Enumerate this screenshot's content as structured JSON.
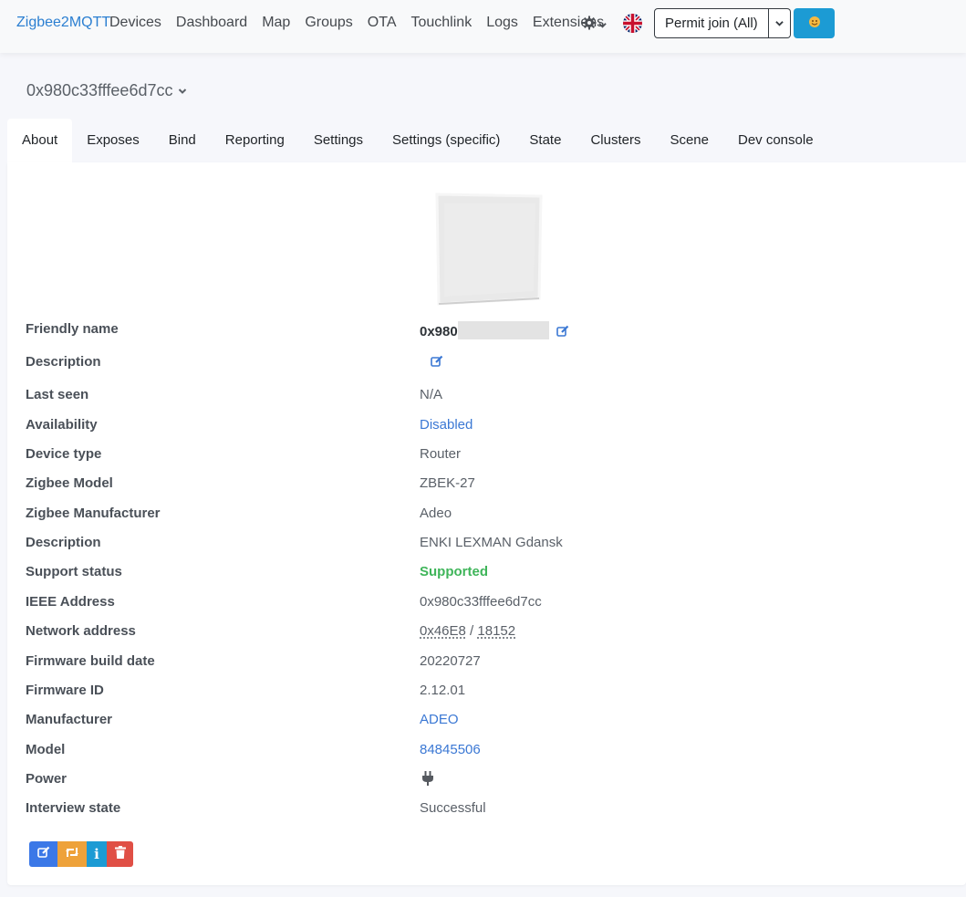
{
  "navbar": {
    "brand": "Zigbee2MQTT",
    "links": [
      "Devices",
      "Dashboard",
      "Map",
      "Groups",
      "OTA",
      "Touchlink",
      "Logs",
      "Extensions"
    ],
    "settings_icon": "gear-icon",
    "language_icon": "uk-flag-icon",
    "permit_join_label": "Permit join (All)",
    "donate_icon": "donate-icon"
  },
  "device_select": {
    "label": "0x980c33fffee6d7cc"
  },
  "tabs": [
    "About",
    "Exposes",
    "Bind",
    "Reporting",
    "Settings",
    "Settings (specific)",
    "State",
    "Clusters",
    "Scene",
    "Dev console"
  ],
  "active_tab": "About",
  "about": {
    "friendly_name": {
      "label": "Friendly name",
      "value": "0x980"
    },
    "description_edit": {
      "label": "Description"
    },
    "last_seen": {
      "label": "Last seen",
      "value": "N/A"
    },
    "availability": {
      "label": "Availability",
      "value": "Disabled"
    },
    "device_type": {
      "label": "Device type",
      "value": "Router"
    },
    "zigbee_model": {
      "label": "Zigbee Model",
      "value": "ZBEK-27"
    },
    "zigbee_manufacturer": {
      "label": "Zigbee Manufacturer",
      "value": "Adeo"
    },
    "description": {
      "label": "Description",
      "value": "ENKI LEXMAN Gdansk"
    },
    "support_status": {
      "label": "Support status",
      "value": "Supported"
    },
    "ieee_address": {
      "label": "IEEE Address",
      "value": "0x980c33fffee6d7cc"
    },
    "network_address": {
      "label": "Network address",
      "hex": "0x46E8",
      "separator": " / ",
      "dec": "18152"
    },
    "firmware_build_date": {
      "label": "Firmware build date",
      "value": "20220727"
    },
    "firmware_id": {
      "label": "Firmware ID",
      "value": "2.12.01"
    },
    "manufacturer": {
      "label": "Manufacturer",
      "value": "ADEO"
    },
    "model": {
      "label": "Model",
      "value": "84845506"
    },
    "power": {
      "label": "Power",
      "icon": "plug-icon"
    },
    "interview_state": {
      "label": "Interview state",
      "value": "Successful"
    }
  },
  "actions": {
    "rename_icon": "edit-icon",
    "reconfigure_icon": "retweet-icon",
    "interview_label": "i",
    "remove_icon": "trash-icon"
  },
  "colors": {
    "brand": "#2b7fd1",
    "link": "#3b78d4",
    "supported": "#3fb55a",
    "action_blue": "#3b78e7",
    "action_orange": "#eea23a",
    "action_teal": "#1c9bd4",
    "action_red": "#e04f45"
  }
}
